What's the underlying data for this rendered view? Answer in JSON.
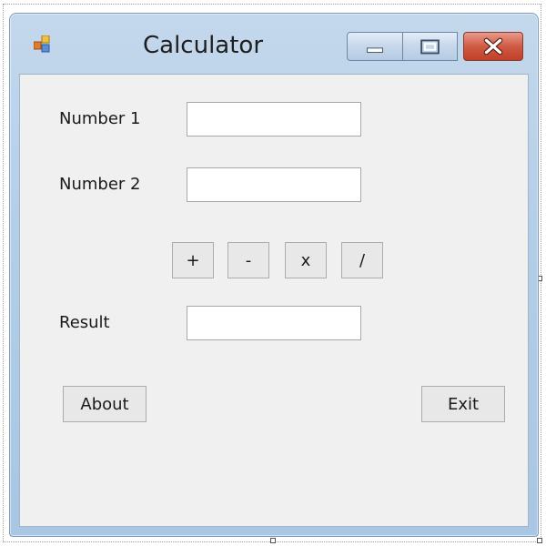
{
  "window": {
    "title": "Calculator",
    "caption_buttons": {
      "minimize": "minimize-icon",
      "maximize": "maximize-icon",
      "close": "close-icon"
    },
    "colors": {
      "frame": "#b3cde6",
      "client": "#f0f0f0",
      "close": "#c13f27"
    }
  },
  "form": {
    "number1_label": "Number 1",
    "number1_value": "",
    "number2_label": "Number 2",
    "number2_value": "",
    "result_label": "Result",
    "result_value": "",
    "operators": {
      "add": "+",
      "subtract": "-",
      "multiply": "x",
      "divide": "/"
    },
    "about_label": "About",
    "exit_label": "Exit"
  }
}
